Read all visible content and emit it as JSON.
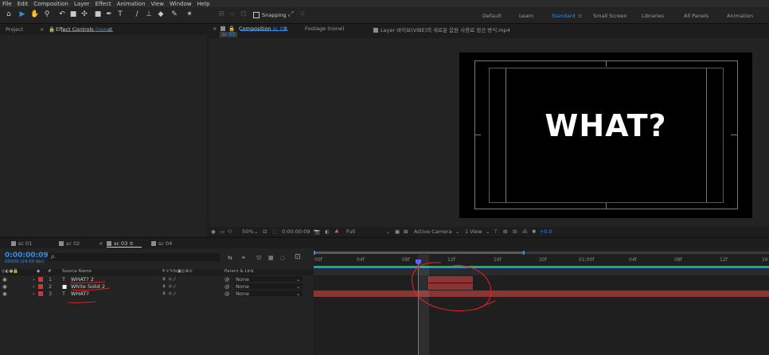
{
  "menu": [
    "File",
    "Edit",
    "Composition",
    "Layer",
    "Effect",
    "Animation",
    "View",
    "Window",
    "Help"
  ],
  "toolbar": {
    "snapping_label": "Snapping",
    "workspaces": [
      "Default",
      "Learn",
      "Standard",
      "Small Screen",
      "Libraries",
      "All Panels",
      "Animation"
    ],
    "active_workspace": "Standard"
  },
  "left_panel": {
    "project_tab": "Project",
    "effect_controls_prefix": "Effect Controls",
    "effect_controls_value": "(none)"
  },
  "comp_panel": {
    "comp_tab": "Composition",
    "comp_name": "sc 03",
    "footage_tab": "Footage",
    "footage_value": "(none)",
    "layer_tab": "Layer 바이브(VIBE)의 새로운 음원 사용료 정산 방식.mp4",
    "breadcrumb": "sc 03",
    "preview_text": "WHAT?"
  },
  "comp_footer": {
    "zoom": "50%",
    "timecode": "0:00:00:09",
    "resolution": "Full",
    "camera": "Active Camera",
    "views": "1 View",
    "exposure": "+0.0"
  },
  "timeline_tabs": [
    {
      "label": "sc 01",
      "color": "#8c8c8c"
    },
    {
      "label": "sc 02",
      "color": "#8c8c8c"
    },
    {
      "label": "sc 03",
      "color": "#8c8c8c",
      "active": true
    },
    {
      "label": "sc 04",
      "color": "#8c8c8c"
    }
  ],
  "timeline": {
    "current_time": "0:00:00:09",
    "fps_info": "00009 (24.00 fps)",
    "search_placeholder": "ρ.",
    "header_source_name": "Source Name",
    "header_parent": "Parent & Link",
    "ruler": [
      "00f",
      "04f",
      "08f",
      "12f",
      "16f",
      "20f",
      "01:00f",
      "04f",
      "08f",
      "12f",
      "16"
    ],
    "layers": [
      {
        "num": "1",
        "type": "T",
        "name": "WHAT? 2",
        "parent": "None",
        "color": "#c13d3d"
      },
      {
        "num": "2",
        "type": "■",
        "name": "White Solid 2",
        "parent": "None",
        "color": "#c13d3d"
      },
      {
        "num": "3",
        "type": "T",
        "name": "WHAT?",
        "parent": "None",
        "color": "#c13d3d"
      }
    ]
  },
  "colors": {
    "accent": "#2d8ceb",
    "layer_bar": "#8a3434",
    "annotation": "#e02020"
  }
}
